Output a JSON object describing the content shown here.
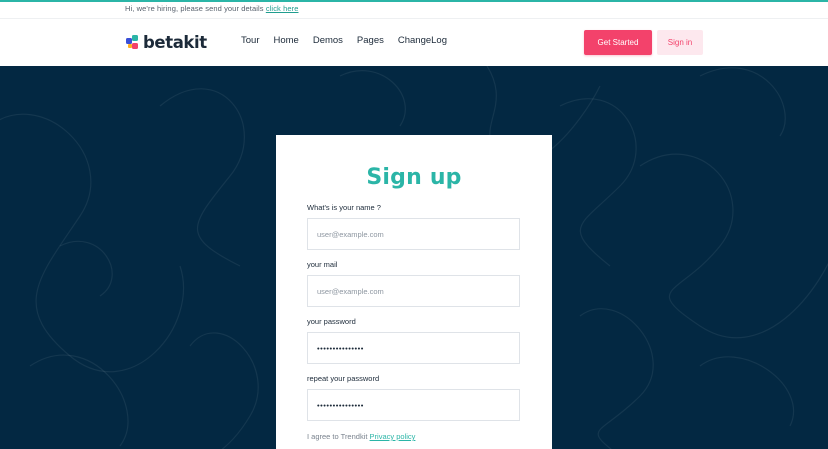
{
  "announcement": {
    "text": "Hi, we're hiring, please send your details",
    "link_label": "click here"
  },
  "header": {
    "logo_text": "betakit",
    "nav": [
      "Tour",
      "Home",
      "Demos",
      "Pages",
      "ChangeLog"
    ],
    "get_started_label": "Get Started",
    "sign_in_label": "Sign in"
  },
  "signup": {
    "title": "Sign up",
    "fields": [
      {
        "label": "What's is your name ?",
        "placeholder": "user@example.com",
        "value": ""
      },
      {
        "label": "your mail",
        "placeholder": "user@example.com",
        "value": ""
      },
      {
        "label": "your password",
        "placeholder": "",
        "value": "•••••••••••••••"
      },
      {
        "label": "repeat your password",
        "placeholder": "",
        "value": "•••••••••••••••"
      }
    ],
    "agree_text": "I agree to Trendkit",
    "privacy_label": "Privacy policy"
  },
  "colors": {
    "accent": "#2bb5a7",
    "brand_pink": "#f3426b",
    "hero_background": "#032842"
  }
}
